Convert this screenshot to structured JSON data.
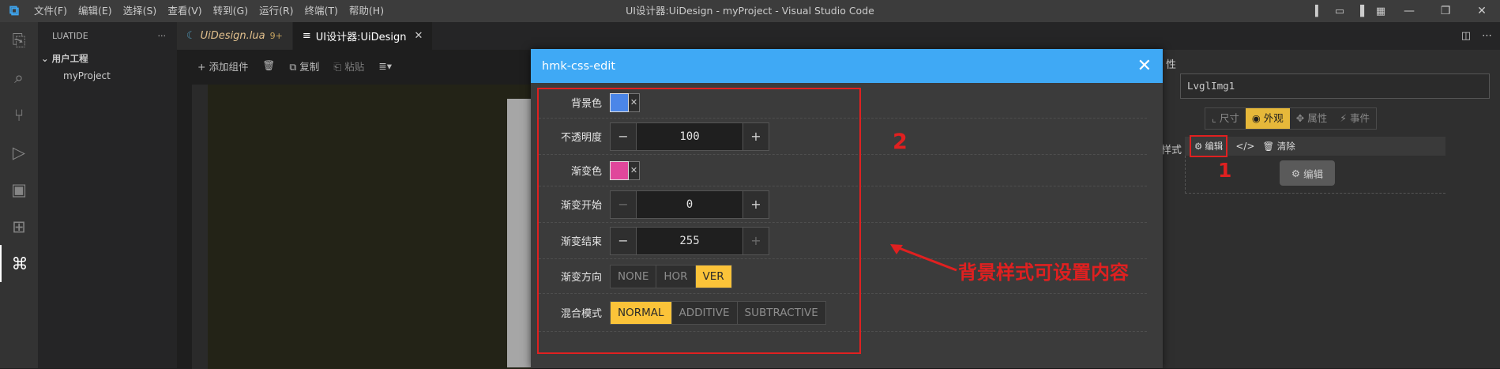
{
  "titlebar": {
    "logo": "VS Code",
    "menu": [
      "文件(F)",
      "编辑(E)",
      "选择(S)",
      "查看(V)",
      "转到(G)",
      "运行(R)",
      "终端(T)",
      "帮助(H)"
    ],
    "window_title": "UI设计器:UiDesign - myProject - Visual Studio Code",
    "minimize": "—",
    "maximize": "❐",
    "close": "✕"
  },
  "activity": [
    "explorer-icon",
    "search-icon",
    "source-control-icon",
    "run-debug-icon",
    "remote-explorer-icon",
    "extensions-icon",
    "chip-icon"
  ],
  "sidebar": {
    "title": "LUATIDE",
    "more": "···",
    "folder": "用户工程",
    "file": "myProject"
  },
  "tabs": [
    {
      "label": "UiDesign.lua",
      "modified": "9+"
    },
    {
      "label": "UI设计器:UiDesign",
      "close": "✕"
    }
  ],
  "toolbar": {
    "add": "添加组件",
    "copy": "复制",
    "paste": "粘贴"
  },
  "right_panel": {
    "header_fragment": "性",
    "name_value": "LvglImg1",
    "tabs": [
      "尺寸",
      "外观",
      "属性",
      "事件"
    ],
    "active_tab": "外观",
    "style_label": "样式",
    "edit": "编辑",
    "clear": "清除",
    "edit_button": "编辑",
    "marker": "1"
  },
  "modal": {
    "title": "hmk-css-edit",
    "close": "✕",
    "marker": "2",
    "rows": {
      "bg_color": {
        "label": "背景色",
        "color": "#4b86e8"
      },
      "opacity": {
        "label": "不透明度",
        "value": "100",
        "minus": "−",
        "plus": "+"
      },
      "grad_color": {
        "label": "渐变色",
        "color": "#e0479b"
      },
      "grad_start": {
        "label": "渐变开始",
        "value": "0",
        "minus": "−",
        "plus": "+"
      },
      "grad_end": {
        "label": "渐变结束",
        "value": "255",
        "minus": "−",
        "plus": "+"
      },
      "grad_dir": {
        "label": "渐变方向",
        "options": [
          "NONE",
          "HOR",
          "VER"
        ],
        "selected": "VER"
      },
      "blend": {
        "label": "混合模式",
        "options": [
          "NORMAL",
          "ADDITIVE",
          "SUBTRACTIVE"
        ],
        "selected": "NORMAL"
      }
    }
  },
  "annotation": {
    "text": "背景样式可设置内容"
  },
  "colors": {
    "accent_blue": "#3fa9f5",
    "highlight_yellow": "#fbc339",
    "annotation_red": "#e02020"
  }
}
